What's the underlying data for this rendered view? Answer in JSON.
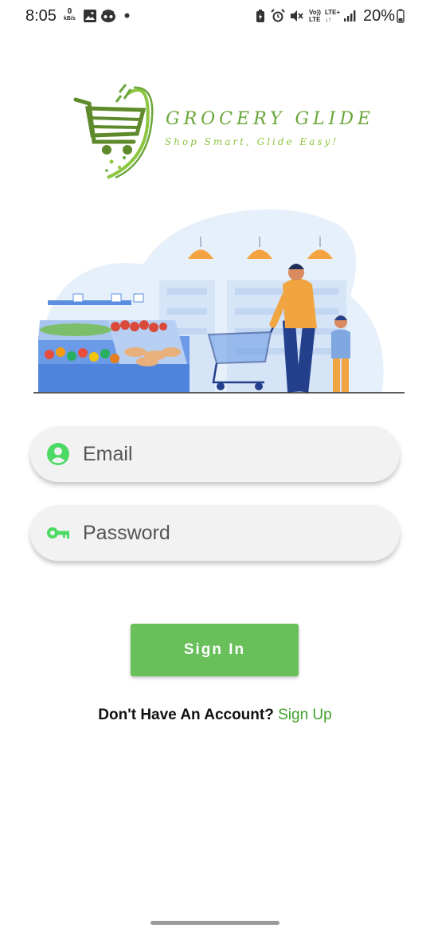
{
  "status_bar": {
    "time": "8:05",
    "net_speed_value": "0",
    "net_speed_unit": "kB/s",
    "volte": "Vo))",
    "lte_label": "LTE",
    "lte_plus": "LTE+",
    "battery_percent": "20%"
  },
  "brand": {
    "title": "GROCERY GLIDE",
    "tagline": "Shop Smart, Glide Easy!"
  },
  "login_form": {
    "email_placeholder": "Email",
    "password_placeholder": "Password",
    "signin_label": "Sign In"
  },
  "signup": {
    "prompt": "Don't Have An Account?",
    "link": "Sign Up"
  },
  "colors": {
    "accent_green": "#69bf5a",
    "icon_green": "#4cd964",
    "link_green": "#3fa12a"
  }
}
